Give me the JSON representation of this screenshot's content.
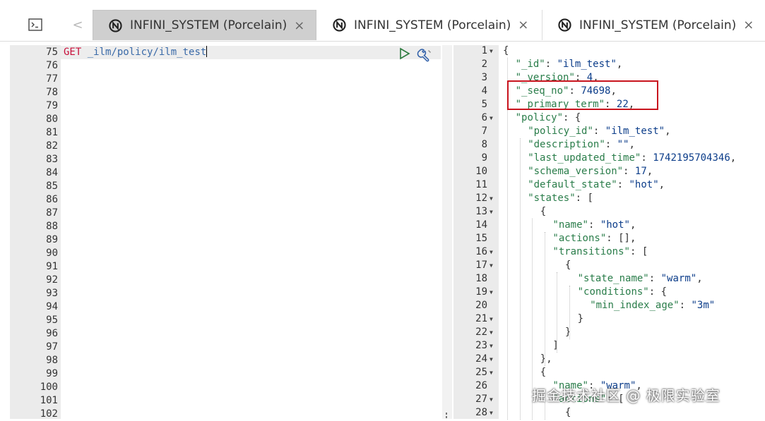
{
  "tabs": [
    {
      "label": "INFINI_SYSTEM (Porcelain)",
      "active": true,
      "close": "×"
    },
    {
      "label": "INFINI_SYSTEM (Porcelain)",
      "active": false,
      "close": "×"
    },
    {
      "label": "INFINI_SYSTEM (Porcelain)",
      "active": false,
      "close": "×"
    }
  ],
  "nav": {
    "prev": "<"
  },
  "left_editor": {
    "line_numbers": [
      "75",
      "76",
      "77",
      "78",
      "79",
      "80",
      "81",
      "82",
      "83",
      "84",
      "85",
      "86",
      "87",
      "88",
      "89",
      "90",
      "91",
      "92",
      "93",
      "94",
      "95",
      "96",
      "97",
      "98",
      "99",
      "100",
      "101",
      "102"
    ],
    "method": "GET",
    "path": "_ilm/policy/ilm_test"
  },
  "right_editor": {
    "lines": [
      {
        "n": "1",
        "fold": true,
        "indent": 0,
        "parts": [
          [
            "p",
            "{"
          ]
        ]
      },
      {
        "n": "2",
        "indent": 1,
        "parts": [
          [
            "k",
            "\"_id\""
          ],
          [
            "p",
            ": "
          ],
          [
            "s",
            "\"ilm_test\""
          ],
          [
            "p",
            ","
          ]
        ]
      },
      {
        "n": "3",
        "indent": 1,
        "parts": [
          [
            "k",
            "\"_version\""
          ],
          [
            "p",
            ": "
          ],
          [
            "n",
            "4"
          ],
          [
            "p",
            ","
          ]
        ]
      },
      {
        "n": "4",
        "indent": 1,
        "parts": [
          [
            "k",
            "\"_seq_no\""
          ],
          [
            "p",
            ": "
          ],
          [
            "n",
            "74698"
          ],
          [
            "p",
            ","
          ]
        ]
      },
      {
        "n": "5",
        "indent": 1,
        "parts": [
          [
            "k",
            "\"_primary_term\""
          ],
          [
            "p",
            ": "
          ],
          [
            "n",
            "22"
          ],
          [
            "p",
            ","
          ]
        ]
      },
      {
        "n": "6",
        "fold": true,
        "indent": 1,
        "parts": [
          [
            "k",
            "\"policy\""
          ],
          [
            "p",
            ": {"
          ]
        ]
      },
      {
        "n": "7",
        "indent": 2,
        "parts": [
          [
            "k",
            "\"policy_id\""
          ],
          [
            "p",
            ": "
          ],
          [
            "s",
            "\"ilm_test\""
          ],
          [
            "p",
            ","
          ]
        ]
      },
      {
        "n": "8",
        "indent": 2,
        "parts": [
          [
            "k",
            "\"description\""
          ],
          [
            "p",
            ": "
          ],
          [
            "s",
            "\"\""
          ],
          [
            "p",
            ","
          ]
        ]
      },
      {
        "n": "9",
        "indent": 2,
        "parts": [
          [
            "k",
            "\"last_updated_time\""
          ],
          [
            "p",
            ": "
          ],
          [
            "n",
            "1742195704346"
          ],
          [
            "p",
            ","
          ]
        ]
      },
      {
        "n": "10",
        "indent": 2,
        "parts": [
          [
            "k",
            "\"schema_version\""
          ],
          [
            "p",
            ": "
          ],
          [
            "n",
            "17"
          ],
          [
            "p",
            ","
          ]
        ]
      },
      {
        "n": "11",
        "indent": 2,
        "parts": [
          [
            "k",
            "\"default_state\""
          ],
          [
            "p",
            ": "
          ],
          [
            "s",
            "\"hot\""
          ],
          [
            "p",
            ","
          ]
        ]
      },
      {
        "n": "12",
        "fold": true,
        "indent": 2,
        "parts": [
          [
            "k",
            "\"states\""
          ],
          [
            "p",
            ": ["
          ]
        ]
      },
      {
        "n": "13",
        "fold": true,
        "indent": 3,
        "parts": [
          [
            "p",
            "{"
          ]
        ]
      },
      {
        "n": "14",
        "indent": 4,
        "parts": [
          [
            "k",
            "\"name\""
          ],
          [
            "p",
            ": "
          ],
          [
            "s",
            "\"hot\""
          ],
          [
            "p",
            ","
          ]
        ]
      },
      {
        "n": "15",
        "indent": 4,
        "parts": [
          [
            "k",
            "\"actions\""
          ],
          [
            "p",
            ": [],"
          ]
        ]
      },
      {
        "n": "16",
        "fold": true,
        "indent": 4,
        "parts": [
          [
            "k",
            "\"transitions\""
          ],
          [
            "p",
            ": ["
          ]
        ]
      },
      {
        "n": "17",
        "fold": true,
        "indent": 5,
        "parts": [
          [
            "p",
            "{"
          ]
        ]
      },
      {
        "n": "18",
        "indent": 6,
        "parts": [
          [
            "k",
            "\"state_name\""
          ],
          [
            "p",
            ": "
          ],
          [
            "s",
            "\"warm\""
          ],
          [
            "p",
            ","
          ]
        ]
      },
      {
        "n": "19",
        "fold": true,
        "indent": 6,
        "parts": [
          [
            "k",
            "\"conditions\""
          ],
          [
            "p",
            ": {"
          ]
        ]
      },
      {
        "n": "20",
        "indent": 7,
        "parts": [
          [
            "k",
            "\"min_index_age\""
          ],
          [
            "p",
            ": "
          ],
          [
            "s",
            "\"3m\""
          ]
        ]
      },
      {
        "n": "21",
        "fold": true,
        "indent": 6,
        "parts": [
          [
            "p",
            "}"
          ]
        ]
      },
      {
        "n": "22",
        "fold": true,
        "indent": 5,
        "parts": [
          [
            "p",
            "}"
          ]
        ]
      },
      {
        "n": "23",
        "fold": true,
        "indent": 4,
        "parts": [
          [
            "p",
            "]"
          ]
        ]
      },
      {
        "n": "24",
        "fold": true,
        "indent": 3,
        "parts": [
          [
            "p",
            "},"
          ]
        ]
      },
      {
        "n": "25",
        "fold": true,
        "indent": 3,
        "parts": [
          [
            "p",
            "{"
          ]
        ]
      },
      {
        "n": "26",
        "indent": 4,
        "parts": [
          [
            "k",
            "\"name\""
          ],
          [
            "p",
            ": "
          ],
          [
            "s",
            "\"warm\""
          ],
          [
            "p",
            ","
          ]
        ]
      },
      {
        "n": "27",
        "fold": true,
        "indent": 4,
        "parts": [
          [
            "k",
            "\"actions\""
          ],
          [
            "p",
            ": ["
          ]
        ]
      },
      {
        "n": "28",
        "fold": true,
        "indent": 5,
        "parts": [
          [
            "p",
            "{"
          ]
        ]
      }
    ]
  },
  "watermark": "掘金技术社区 @ 极限实验室",
  "colors": {
    "highlight": "#c8141e",
    "key": "#2a7d4a",
    "value": "#0c3d8a",
    "method": "#c8103a"
  }
}
